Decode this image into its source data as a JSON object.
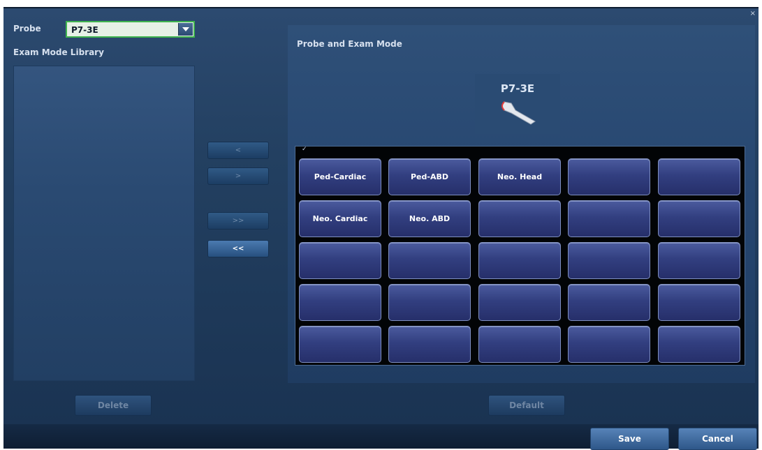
{
  "probe": {
    "label": "Probe",
    "selected": "P7-3E"
  },
  "library": {
    "title": "Exam Mode Library",
    "items": []
  },
  "transfer_buttons": {
    "remove_one": "<",
    "add_one": ">",
    "add_all": ">>",
    "remove_all": "<<"
  },
  "panel": {
    "title": "Probe and Exam Mode",
    "probe_name": "P7-3E",
    "grid": [
      [
        "Ped-Cardiac",
        "Ped-ABD",
        "Neo. Head",
        "",
        ""
      ],
      [
        "Neo. Cardiac",
        "Neo. ABD",
        "",
        "",
        ""
      ],
      [
        "",
        "",
        "",
        "",
        ""
      ],
      [
        "",
        "",
        "",
        "",
        ""
      ],
      [
        "",
        "",
        "",
        "",
        ""
      ]
    ],
    "checked": "✓"
  },
  "actions": {
    "delete": "Delete",
    "default": "Default",
    "save": "Save",
    "cancel": "Cancel"
  },
  "colors": {
    "selection_border": "#3fb34f",
    "cell_fill": "#323f80",
    "background": "#234061"
  }
}
